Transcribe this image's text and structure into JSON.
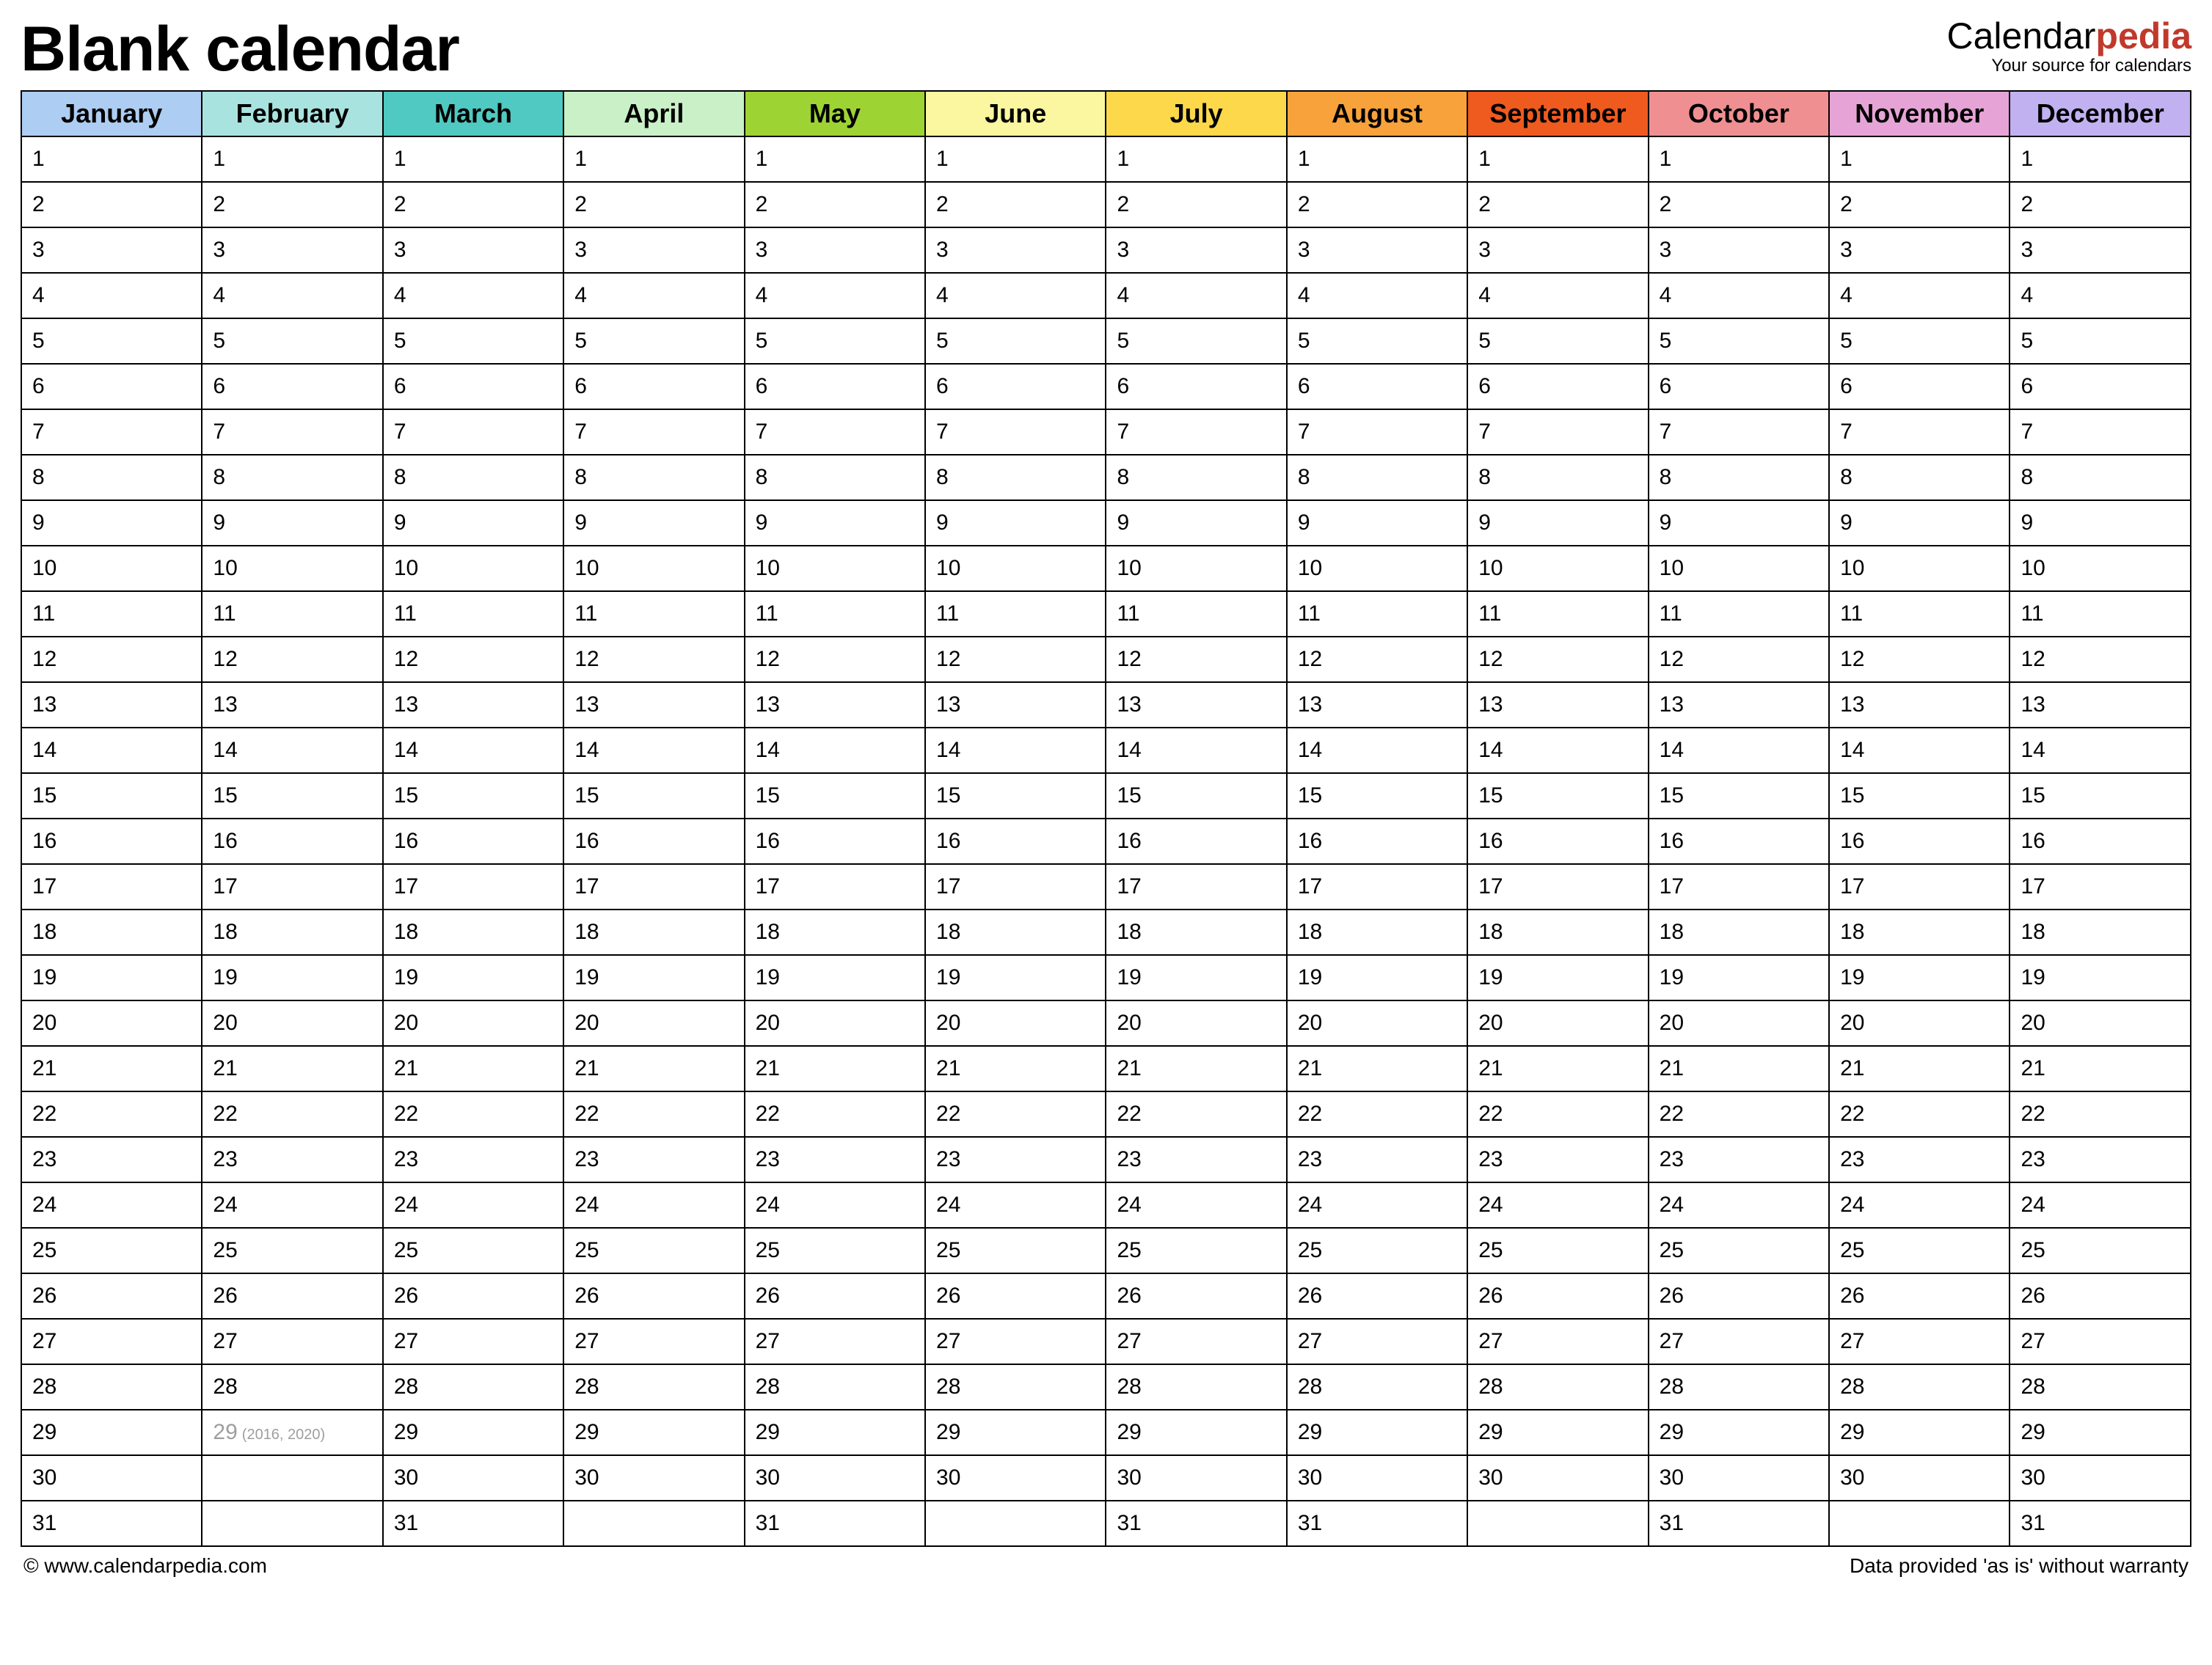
{
  "title": "Blank calendar",
  "brand": {
    "part1": "Calendar",
    "part2": "pedia",
    "tagline": "Your source for calendars"
  },
  "months": [
    {
      "name": "January",
      "color": "#aecdf2",
      "days": 31
    },
    {
      "name": "February",
      "color": "#a9e3e0",
      "days": 29,
      "special": {
        "day": 29,
        "note": "(2016, 2020)",
        "gray": true
      }
    },
    {
      "name": "March",
      "color": "#4fc9c1",
      "days": 31
    },
    {
      "name": "April",
      "color": "#c9f0c6",
      "days": 30
    },
    {
      "name": "May",
      "color": "#9ed334",
      "days": 31
    },
    {
      "name": "June",
      "color": "#faf7a0",
      "days": 30
    },
    {
      "name": "July",
      "color": "#fcd84a",
      "days": 31
    },
    {
      "name": "August",
      "color": "#f7a23b",
      "days": 31
    },
    {
      "name": "September",
      "color": "#ef5a1f",
      "days": 30
    },
    {
      "name": "October",
      "color": "#f08f92",
      "days": 31
    },
    {
      "name": "November",
      "color": "#e6a4d6",
      "days": 30
    },
    {
      "name": "December",
      "color": "#c2b1f0",
      "days": 31
    }
  ],
  "max_days": 31,
  "footer": {
    "left": "© www.calendarpedia.com",
    "right": "Data provided 'as is' without warranty"
  }
}
